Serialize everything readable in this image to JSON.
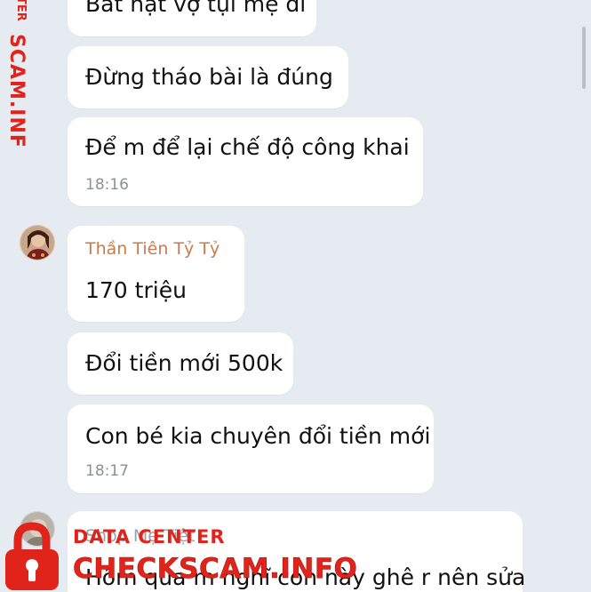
{
  "messages_group_1": [
    {
      "text": "Bắt nạt vợ tụi mẹ đi"
    },
    {
      "text": "Đừng tháo bài là đúng"
    },
    {
      "text": "Để m để lại chế độ công khai",
      "time": "18:16"
    }
  ],
  "messages_group_2": {
    "sender": "Thần Tiên Tỷ Tỷ",
    "items": [
      {
        "text": "170 triệu"
      },
      {
        "text": "Đổi tiền mới 500k"
      },
      {
        "text": "Con bé kia chuyên đổi tiền mới",
        "time": "18:17"
      }
    ]
  },
  "messages_group_3": {
    "sender": "Shop Mẹ Tiệt",
    "items": [
      {
        "text": "Hôm qua m nghĩ con này ghê r nên sửa"
      }
    ]
  },
  "watermark": {
    "side_text": "SCAM.INFO",
    "side_text_partial": "TER",
    "line1": "DATA CENTER",
    "line2": "CHECKSCAM.INFO",
    "color": "#e0241b"
  },
  "colors": {
    "background": "#e6ebf1",
    "bubble": "#ffffff",
    "sender_name": "#c97b4e",
    "timestamp": "#8a9099"
  }
}
